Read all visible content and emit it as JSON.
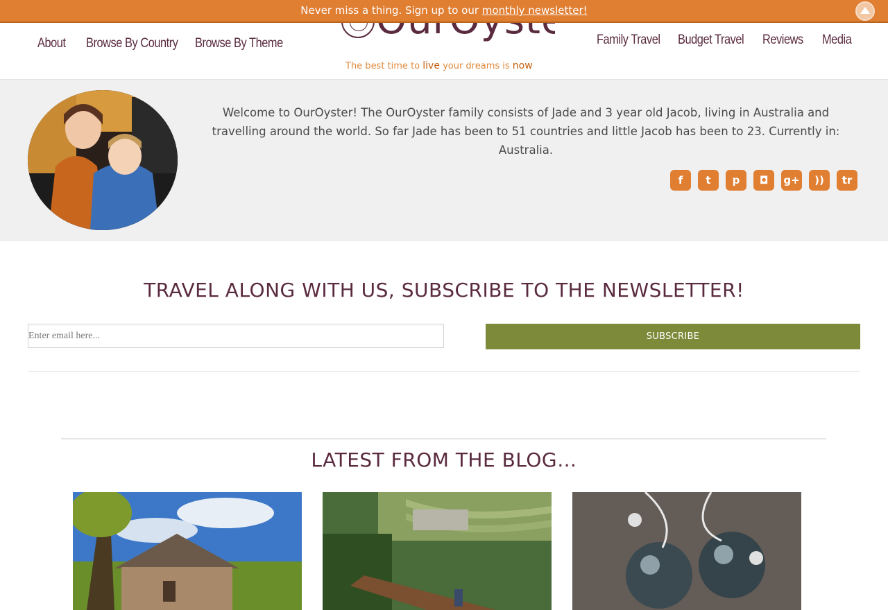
{
  "notice": {
    "text": "Never miss a thing. Sign up to our",
    "link_text": "monthly newsletter!"
  },
  "nav_left": [
    "About",
    "Browse By Country",
    "Browse By Theme"
  ],
  "nav_right": [
    "Family Travel",
    "Budget Travel",
    "Reviews",
    "Media"
  ],
  "logo": {
    "name": "OurOyster",
    "tagline_parts": [
      "The best time to ",
      "live",
      " your dreams is ",
      "now"
    ]
  },
  "welcome_text": "Welcome to OurOyster! The OurOyster family consists of Jade and 3 year old Jacob, living in Australia and travelling around the world. So far Jade has been to 51 countries and little Jacob has been to 23. Currently in: Australia.",
  "social": [
    {
      "icon": "facebook-icon",
      "glyph": "f"
    },
    {
      "icon": "twitter-icon",
      "glyph": "t"
    },
    {
      "icon": "pinterest-icon",
      "glyph": "p"
    },
    {
      "icon": "instagram-icon",
      "glyph": "◘"
    },
    {
      "icon": "google-plus-icon",
      "glyph": "g+"
    },
    {
      "icon": "rss-icon",
      "glyph": "))"
    },
    {
      "icon": "tripadvisor-icon",
      "glyph": "tr"
    }
  ],
  "newsletter": {
    "heading": "TRAVEL ALONG WITH US, SUBSCRIBE TO THE NEWSLETTER!",
    "placeholder": "Enter email here...",
    "button_label": "SUBSCRIBE"
  },
  "blog": {
    "heading": "LATEST FROM THE BLOG…"
  },
  "colors": {
    "accent_orange": "#e07e32",
    "brand_plum": "#5a2a3f",
    "button_olive": "#7d8a3a"
  }
}
